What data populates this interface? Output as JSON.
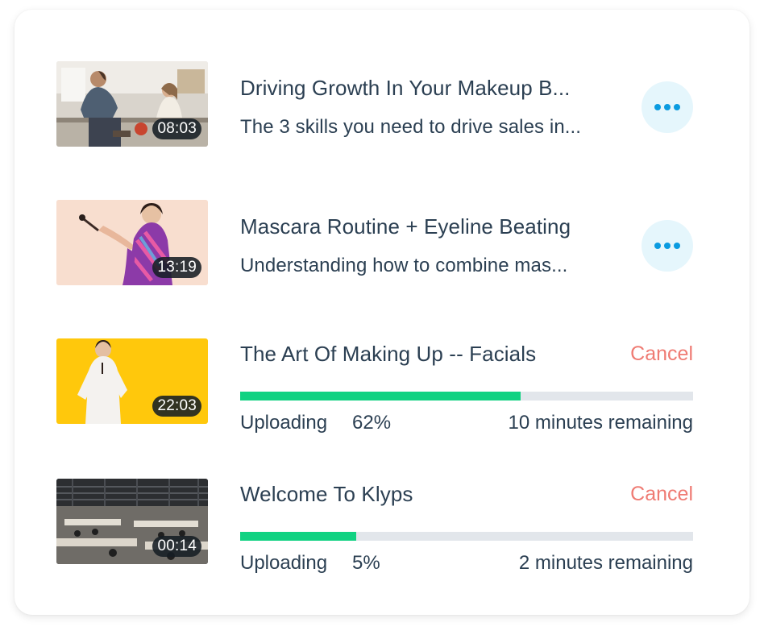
{
  "items": [
    {
      "title": "Driving Growth In Your Makeup B...",
      "subtitle": "The 3 skills you need to drive sales in...",
      "duration": "08:03",
      "thumbnail": "kitchen-couple-photo",
      "action_icon": "more-icon"
    },
    {
      "title": "Mascara Routine + Eyeline Beating",
      "subtitle": "Understanding how to combine mas...",
      "duration": "13:19",
      "thumbnail": "woman-makeup-brush-photo",
      "action_icon": "more-icon"
    },
    {
      "title": "The Art Of Making Up -- Facials",
      "duration": "22:03",
      "thumbnail": "woman-yellow-background-photo",
      "cancel_label": "Cancel",
      "status_label": "Uploading",
      "percent_label": "62%",
      "progress": 0.62,
      "remaining": "10 minutes remaining"
    },
    {
      "title": "Welcome To Klyps",
      "duration": "00:14",
      "thumbnail": "open-office-photo",
      "cancel_label": "Cancel",
      "status_label": "Uploading",
      "percent_label": "5%",
      "progress": 0.256,
      "remaining": "2 minutes remaining"
    }
  ],
  "colors": {
    "text": "#2b3f52",
    "accent_dots": "#0a9be0",
    "more_button_bg": "#e5f6fc",
    "cancel": "#ef7b73",
    "progress_fill": "#11d282",
    "progress_track": "#e2e6eb"
  }
}
